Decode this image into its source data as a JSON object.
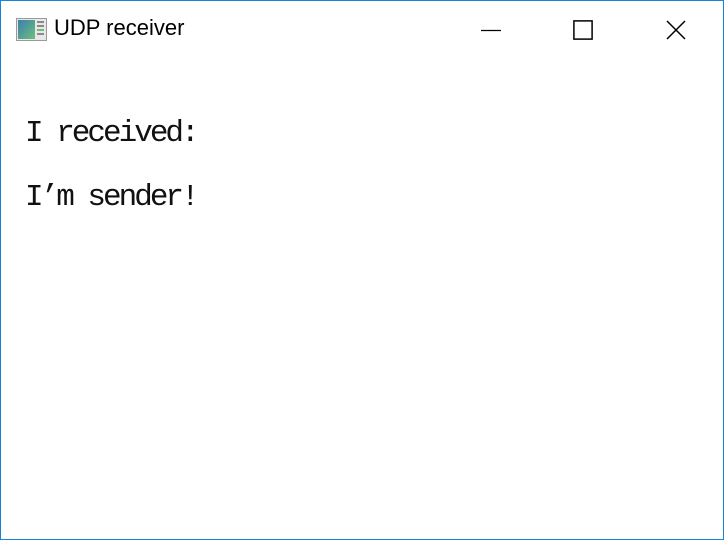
{
  "window": {
    "title": "UDP receiver",
    "icons": {
      "app": "app-window-icon",
      "minimize": "minimize-icon",
      "maximize": "maximize-icon",
      "close": "close-icon"
    },
    "accent_color": "#1883d7"
  },
  "content": {
    "lines": [
      "I received:",
      "I’m sender!"
    ]
  }
}
